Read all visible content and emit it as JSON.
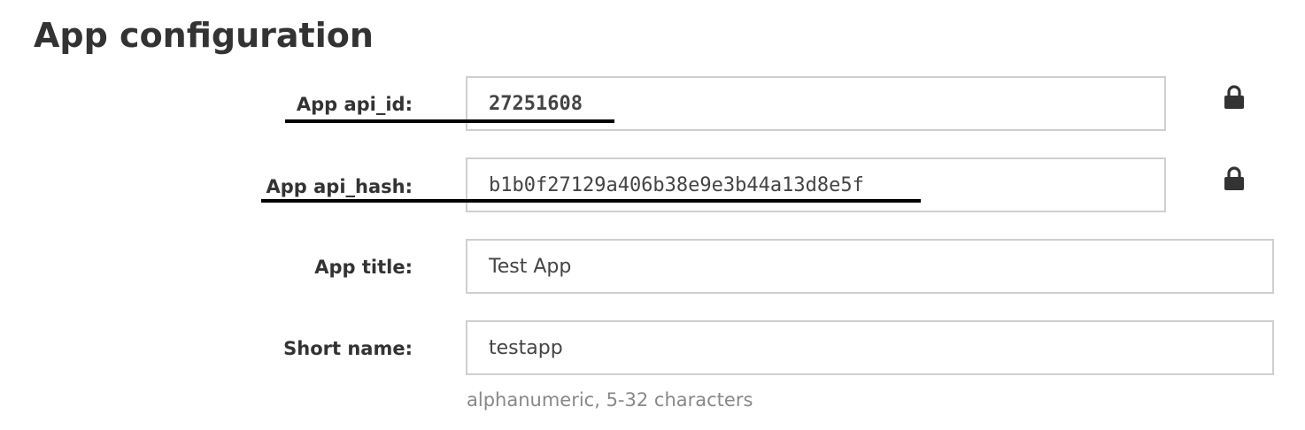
{
  "page": {
    "title": "App configuration"
  },
  "form": {
    "fields": [
      {
        "label": "App api_id:",
        "value": "27251608",
        "locked": true
      },
      {
        "label": "App api_hash:",
        "value": "b1b0f27129a406b38e9e3b44a13d8e5f",
        "locked": true
      },
      {
        "label": "App title:",
        "value": "Test App",
        "locked": false
      },
      {
        "label": "Short name:",
        "value": "testapp",
        "locked": false
      }
    ],
    "short_name_hint": "alphanumeric, 5-32 characters"
  },
  "icons": {
    "lock": "lock-icon"
  },
  "colors": {
    "text": "#333333",
    "input_border": "#cfcfcf",
    "hint": "#888888",
    "annotation_underline": "#000000"
  }
}
